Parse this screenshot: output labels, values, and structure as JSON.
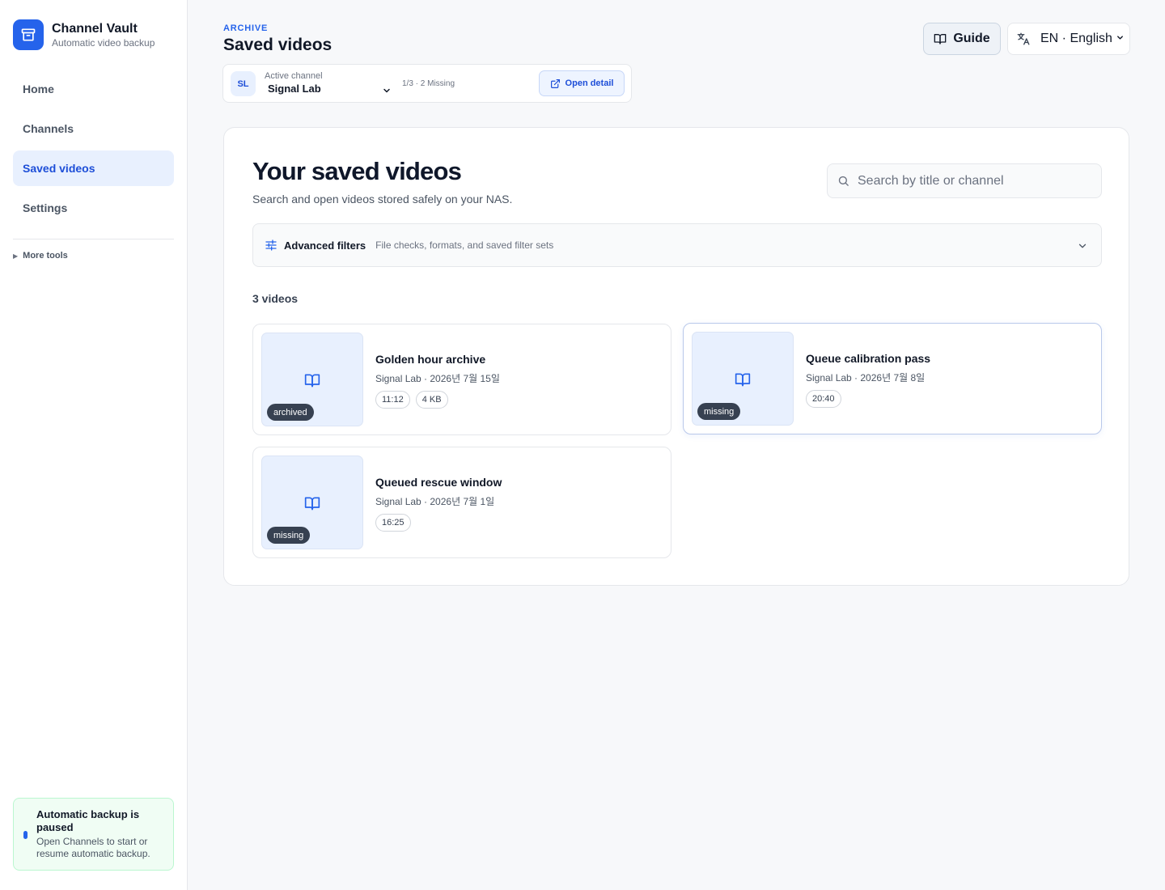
{
  "brand": {
    "name": "Channel Vault",
    "subtitle": "Automatic video backup",
    "logo_icon": "archive-box-icon",
    "accent_color": "#2563eb"
  },
  "sidebar": {
    "items": [
      {
        "label": "Home",
        "active": false
      },
      {
        "label": "Channels",
        "active": false
      },
      {
        "label": "Saved videos",
        "active": true
      },
      {
        "label": "Settings",
        "active": false
      }
    ],
    "more_tools_label": "More tools",
    "backup_status": {
      "title": "Automatic backup is paused",
      "body": "Open Channels to start or resume automatic backup."
    }
  },
  "header": {
    "eyebrow": "ARCHIVE",
    "title": "Saved videos",
    "guide_label": "Guide",
    "language_label": "EN · English"
  },
  "channel_bar": {
    "avatar_initials": "SL",
    "label": "Active channel",
    "selected_channel": "Signal Lab",
    "status": "1/3 · 2 Missing",
    "open_detail_label": "Open detail"
  },
  "main": {
    "title": "Your saved videos",
    "subtitle": "Search and open videos stored safely on your NAS.",
    "search_placeholder": "Search by title or channel",
    "filters": {
      "title": "Advanced filters",
      "description": "File checks, formats, and saved filter sets"
    },
    "count_label": "3 videos"
  },
  "videos": [
    {
      "title": "Golden hour archive",
      "meta": "Signal Lab · 2026년 7월 15일",
      "badge": "archived",
      "chips": [
        "11:12",
        "4 KB"
      ]
    },
    {
      "title": "Queue calibration pass",
      "meta": "Signal Lab · 2026년 7월 8일",
      "badge": "missing",
      "chips": [
        "20:40"
      ]
    },
    {
      "title": "Queued rescue window",
      "meta": "Signal Lab · 2026년 7월 1일",
      "badge": "missing",
      "chips": [
        "16:25"
      ]
    }
  ]
}
